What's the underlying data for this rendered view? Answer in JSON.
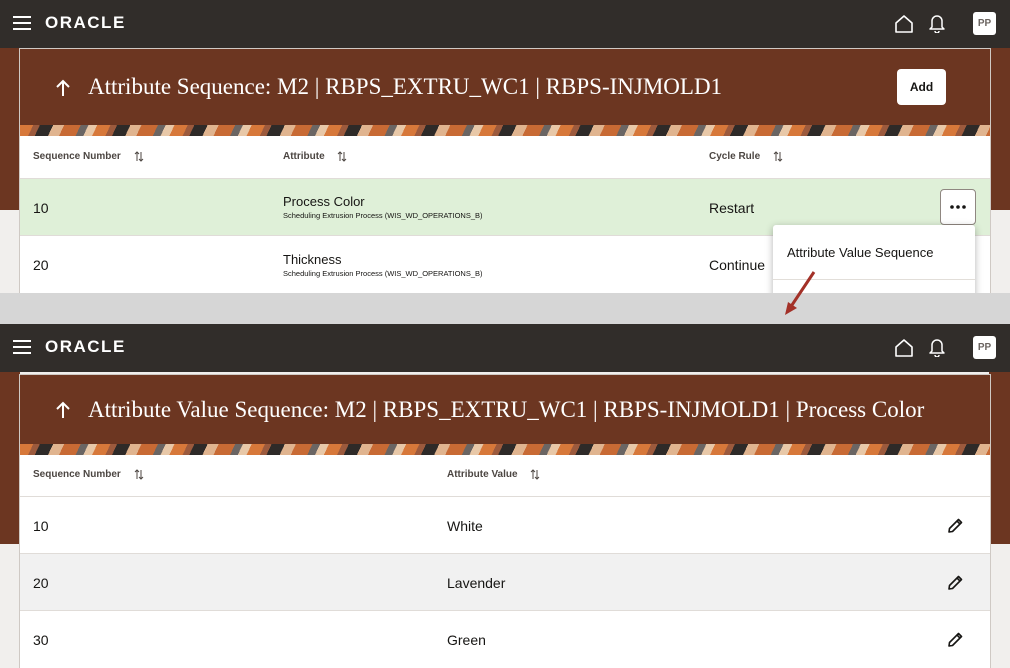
{
  "app": {
    "logo": "ORACLE",
    "avatar_initials": "PP"
  },
  "panel_top": {
    "title": "Attribute Sequence: M2 | RBPS_EXTRU_WC1 | RBPS-INJMOLD1",
    "add_label": "Add",
    "columns": [
      "Sequence Number",
      "Attribute",
      "Cycle Rule"
    ],
    "rows": [
      {
        "sequence": "10",
        "attribute": "Process Color",
        "detail": "Scheduling Extrusion Process (WIS_WD_OPERATIONS_B)",
        "cycle_rule": "Restart",
        "selected": true
      },
      {
        "sequence": "20",
        "attribute": "Thickness",
        "detail": "Scheduling Extrusion Process (WIS_WD_OPERATIONS_B)",
        "cycle_rule": "Continue",
        "selected": false
      }
    ],
    "menu": {
      "items": [
        "Attribute Value Sequence"
      ]
    }
  },
  "panel_bottom": {
    "title": "Attribute Value Sequence: M2 | RBPS_EXTRU_WC1 | RBPS-INJMOLD1 | Process Color",
    "columns": [
      "Sequence Number",
      "Attribute Value"
    ],
    "rows": [
      {
        "sequence": "10",
        "value": "White"
      },
      {
        "sequence": "20",
        "value": "Lavender"
      },
      {
        "sequence": "30",
        "value": "Green"
      }
    ]
  },
  "colors": {
    "header_bar": "#312d2a",
    "banner": "#6c3621",
    "selected_row": "#dff0d8",
    "arrow": "#a33128"
  },
  "icons": [
    "menu-icon",
    "home-icon",
    "bell-icon",
    "back-arrow-icon",
    "sort-icon",
    "more-icon",
    "edit-icon"
  ]
}
